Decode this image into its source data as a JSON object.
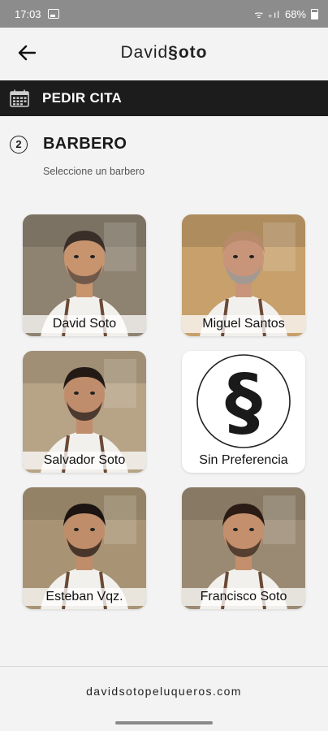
{
  "status_bar": {
    "time": "17:03",
    "battery": "68%",
    "signal_glyphs": "ᯤ ₊ıl"
  },
  "header": {
    "brand_left": "David",
    "brand_mark": "§",
    "brand_right": "oto"
  },
  "section": {
    "title": "PEDIR CITA"
  },
  "step": {
    "number": "2",
    "title": "BARBERO",
    "subtitle": "Seleccione un barbero"
  },
  "barbers": [
    {
      "name": "David Soto",
      "hair": "#3a2f28",
      "skin": "#c8946e",
      "beard": "#5a4a40",
      "bg": "#8e8271"
    },
    {
      "name": "Miguel Santos",
      "hair": "#b68a6a",
      "skin": "#c9957a",
      "beard": "#9a9a9a",
      "bg": "#c7a06b"
    },
    {
      "name": "Salvador Soto",
      "hair": "#231a16",
      "skin": "#c08d6c",
      "beard": "#2e2420",
      "bg": "#b7a386"
    },
    {
      "name": "Sin Preferencia"
    },
    {
      "name": "Esteban Vqz.",
      "hair": "#1b1412",
      "skin": "#bf8d6a",
      "beard": "#2a201c",
      "bg": "#a89474"
    },
    {
      "name": "Francisco Soto",
      "hair": "#2a1c15",
      "skin": "#c48f6c",
      "beard": "#3a2a22",
      "bg": "#9b8a73"
    }
  ],
  "footer": {
    "website": "davidsotopeluqueros.com"
  },
  "colors": {
    "section_bar": "#1c1c1c",
    "background": "#f3f3f3",
    "status_bar": "#8c8c8c"
  }
}
